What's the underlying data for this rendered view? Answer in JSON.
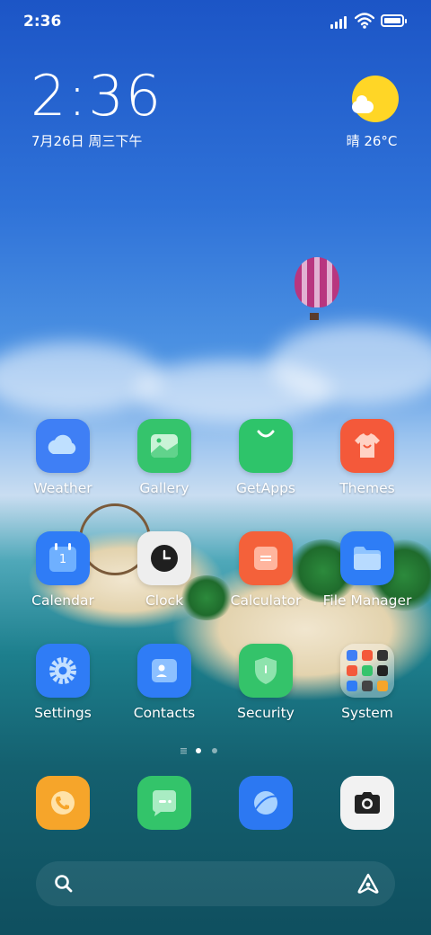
{
  "status_bar": {
    "time": "2:36"
  },
  "widget": {
    "time": "2:36",
    "date": "7月26日 周三下午",
    "weather": "晴 26°C"
  },
  "apps": [
    {
      "label": "Weather",
      "icon": "weather-icon"
    },
    {
      "label": "Gallery",
      "icon": "gallery-icon"
    },
    {
      "label": "GetApps",
      "icon": "getapps-icon"
    },
    {
      "label": "Themes",
      "icon": "themes-icon"
    },
    {
      "label": "Calendar",
      "icon": "calendar-icon"
    },
    {
      "label": "Clock",
      "icon": "clock-icon"
    },
    {
      "label": "Calculator",
      "icon": "calculator-icon"
    },
    {
      "label": "File Manager",
      "icon": "folder-icon"
    },
    {
      "label": "Settings",
      "icon": "settings-icon"
    },
    {
      "label": "Contacts",
      "icon": "contacts-icon"
    },
    {
      "label": "Security",
      "icon": "shield-icon"
    },
    {
      "label": "System",
      "icon": "folder-grid-icon"
    }
  ],
  "calendar_day": "1",
  "page_indicator": {
    "pages": 2,
    "current": 1
  },
  "dock": [
    "phone-icon",
    "messages-icon",
    "browser-icon",
    "camera-icon"
  ],
  "search_bar": {
    "left_icon": "search-icon",
    "right_icon": "assistant-icon"
  },
  "colors": {
    "weather": "#3f7ff5",
    "gallery": "#35c46c",
    "getapps": "#2ec46a",
    "themes": "#f4593a",
    "calendar": "#2f7cf6",
    "clock": "#eeeeee",
    "calculator": "#f4613a",
    "file_manager": "#2e7df6",
    "settings": "#2f7cf6",
    "contacts": "#2f7cf6",
    "security": "#34c36a",
    "phone": "#f6a52a",
    "messages": "#33c46a",
    "browser": "#2c78f2",
    "camera": "#f2f2f2",
    "sun": "#ffd626"
  }
}
